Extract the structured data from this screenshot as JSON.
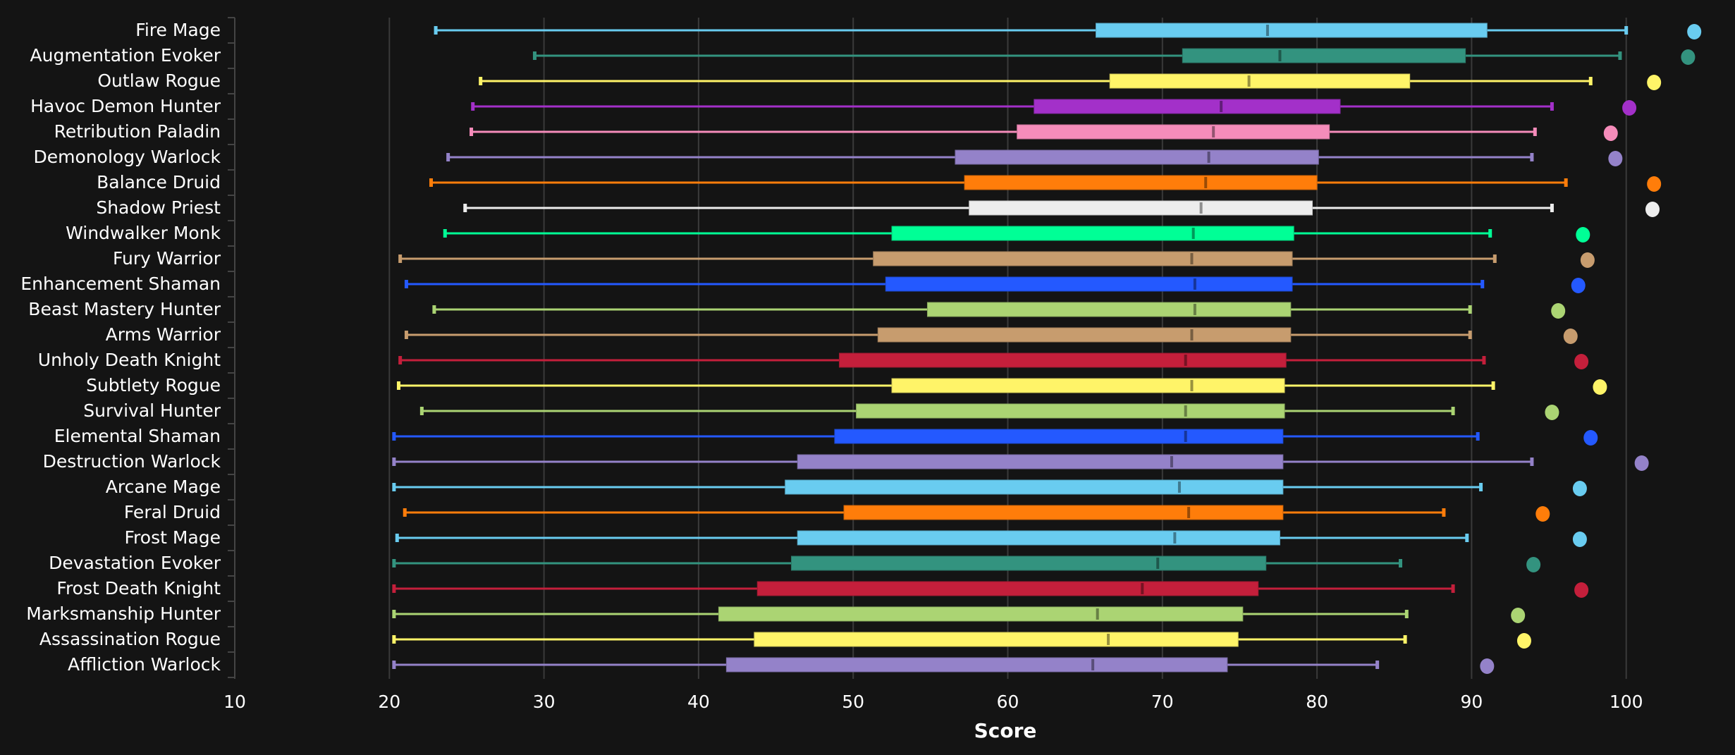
{
  "chart_data": {
    "type": "boxplot",
    "title": "",
    "xlabel": "Score",
    "ylabel": "",
    "xlim": [
      10,
      103
    ],
    "xticks": [
      10,
      20,
      30,
      40,
      50,
      60,
      70,
      80,
      90,
      100
    ],
    "grid": "vertical",
    "legend": "none",
    "series": [
      {
        "name": "Fire Mage",
        "color": "#69CCF0",
        "min": 23.0,
        "q1": 65.7,
        "median": 76.8,
        "q3": 91.0,
        "max": 100.0,
        "top": 104.4
      },
      {
        "name": "Augmentation Evoker",
        "color": "#33937F",
        "min": 29.4,
        "q1": 71.3,
        "median": 77.6,
        "q3": 89.6,
        "max": 99.6,
        "top": 104.0
      },
      {
        "name": "Outlaw Rogue",
        "color": "#FFF468",
        "min": 25.9,
        "q1": 66.6,
        "median": 75.6,
        "q3": 86.0,
        "max": 97.7,
        "top": 101.8
      },
      {
        "name": "Havoc Demon Hunter",
        "color": "#A330C9",
        "min": 25.4,
        "q1": 61.7,
        "median": 73.8,
        "q3": 81.5,
        "max": 95.2,
        "top": 100.2
      },
      {
        "name": "Retribution Paladin",
        "color": "#F58CBA",
        "min": 25.3,
        "q1": 60.6,
        "median": 73.3,
        "q3": 80.8,
        "max": 94.1,
        "top": 99.0
      },
      {
        "name": "Demonology Warlock",
        "color": "#9482C9",
        "min": 23.8,
        "q1": 56.6,
        "median": 73.0,
        "q3": 80.1,
        "max": 93.9,
        "top": 99.3
      },
      {
        "name": "Balance Druid",
        "color": "#FF7D0A",
        "min": 22.7,
        "q1": 57.2,
        "median": 72.8,
        "q3": 80.0,
        "max": 96.1,
        "top": 101.8
      },
      {
        "name": "Shadow Priest",
        "color": "#EDEDED",
        "min": 24.9,
        "q1": 57.5,
        "median": 72.5,
        "q3": 79.7,
        "max": 95.2,
        "top": 101.7
      },
      {
        "name": "Windwalker Monk",
        "color": "#00FF96",
        "min": 23.6,
        "q1": 52.5,
        "median": 72.0,
        "q3": 78.5,
        "max": 91.2,
        "top": 97.2
      },
      {
        "name": "Fury Warrior",
        "color": "#C79C6E",
        "min": 20.7,
        "q1": 51.3,
        "median": 71.9,
        "q3": 78.4,
        "max": 91.5,
        "top": 97.5
      },
      {
        "name": "Enhancement Shaman",
        "color": "#2459FF",
        "min": 21.1,
        "q1": 52.1,
        "median": 72.1,
        "q3": 78.4,
        "max": 90.7,
        "top": 96.9
      },
      {
        "name": "Beast Mastery Hunter",
        "color": "#ABD473",
        "min": 22.9,
        "q1": 54.8,
        "median": 72.1,
        "q3": 78.3,
        "max": 89.9,
        "top": 95.6
      },
      {
        "name": "Arms Warrior",
        "color": "#C79C6E",
        "min": 21.1,
        "q1": 51.6,
        "median": 71.9,
        "q3": 78.3,
        "max": 89.9,
        "top": 96.4
      },
      {
        "name": "Unholy Death Knight",
        "color": "#C41F3B",
        "min": 20.7,
        "q1": 49.1,
        "median": 71.5,
        "q3": 78.0,
        "max": 90.8,
        "top": 97.1
      },
      {
        "name": "Subtlety Rogue",
        "color": "#FFF468",
        "min": 20.6,
        "q1": 52.5,
        "median": 71.9,
        "q3": 77.9,
        "max": 91.4,
        "top": 98.3
      },
      {
        "name": "Survival Hunter",
        "color": "#ABD473",
        "min": 22.1,
        "q1": 50.2,
        "median": 71.5,
        "q3": 77.9,
        "max": 88.8,
        "top": 95.2
      },
      {
        "name": "Elemental Shaman",
        "color": "#2459FF",
        "min": 20.3,
        "q1": 48.8,
        "median": 71.5,
        "q3": 77.8,
        "max": 90.4,
        "top": 97.7
      },
      {
        "name": "Destruction Warlock",
        "color": "#9482C9",
        "min": 20.3,
        "q1": 46.4,
        "median": 70.6,
        "q3": 77.8,
        "max": 93.9,
        "top": 101.0
      },
      {
        "name": "Arcane Mage",
        "color": "#69CCF0",
        "min": 20.3,
        "q1": 45.6,
        "median": 71.1,
        "q3": 77.8,
        "max": 90.6,
        "top": 97.0
      },
      {
        "name": "Feral Druid",
        "color": "#FF7D0A",
        "min": 21.0,
        "q1": 49.4,
        "median": 71.7,
        "q3": 77.8,
        "max": 88.2,
        "top": 94.6
      },
      {
        "name": "Frost Mage",
        "color": "#69CCF0",
        "min": 20.5,
        "q1": 46.4,
        "median": 70.8,
        "q3": 77.6,
        "max": 89.7,
        "top": 97.0
      },
      {
        "name": "Devastation Evoker",
        "color": "#33937F",
        "min": 20.3,
        "q1": 46.0,
        "median": 69.7,
        "q3": 76.7,
        "max": 85.4,
        "top": 94.0
      },
      {
        "name": "Frost Death Knight",
        "color": "#C41F3B",
        "min": 20.3,
        "q1": 43.8,
        "median": 68.7,
        "q3": 76.2,
        "max": 88.8,
        "top": 97.1
      },
      {
        "name": "Marksmanship Hunter",
        "color": "#ABD473",
        "min": 20.3,
        "q1": 41.3,
        "median": 65.8,
        "q3": 75.2,
        "max": 85.8,
        "top": 93.0
      },
      {
        "name": "Assassination Rogue",
        "color": "#FFF468",
        "min": 20.3,
        "q1": 43.6,
        "median": 66.5,
        "q3": 74.9,
        "max": 85.7,
        "top": 93.4
      },
      {
        "name": "Affliction Warlock",
        "color": "#9482C9",
        "min": 20.3,
        "q1": 41.8,
        "median": 65.5,
        "q3": 74.2,
        "max": 83.9,
        "top": 91.0
      }
    ]
  }
}
